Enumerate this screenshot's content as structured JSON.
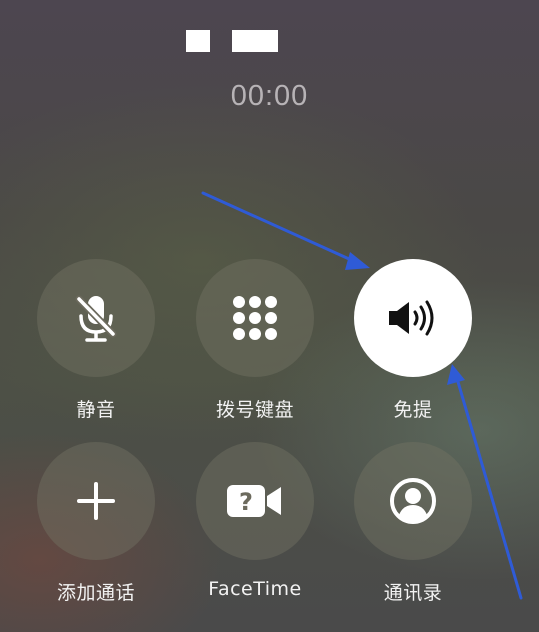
{
  "call": {
    "timer": "00:00"
  },
  "controls": [
    {
      "id": "mute",
      "label": "静音",
      "icon": "mic-slash-icon",
      "active": false
    },
    {
      "id": "keypad",
      "label": "拨号键盘",
      "icon": "keypad-icon",
      "active": false
    },
    {
      "id": "speaker",
      "label": "免提",
      "icon": "speaker-icon",
      "active": true
    },
    {
      "id": "add_call",
      "label": "添加通话",
      "icon": "plus-icon",
      "active": false
    },
    {
      "id": "facetime",
      "label": "FaceTime",
      "icon": "facetime-video-icon",
      "active": false
    },
    {
      "id": "contacts",
      "label": "通讯录",
      "icon": "person-circle-icon",
      "active": false
    }
  ],
  "colors": {
    "button_bg": "#6f6e5f",
    "active_button_bg": "#ffffff",
    "label": "#f2f2f2",
    "timer": "#b7b3b6",
    "annotation_arrow": "#2f5bd6"
  }
}
